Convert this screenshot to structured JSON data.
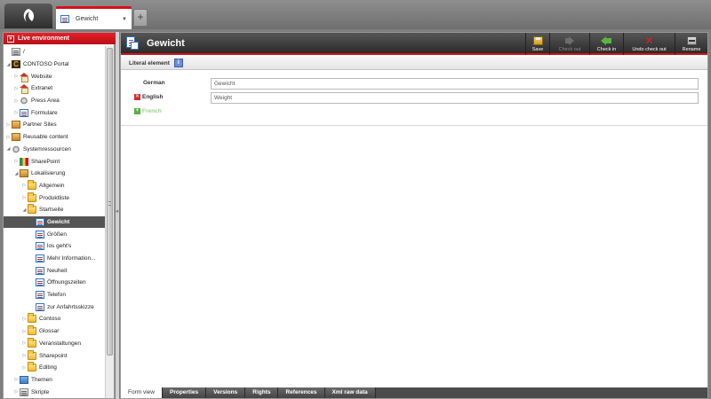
{
  "topbar": {
    "tab_label": "Gewicht",
    "add_tab_glyph": "+"
  },
  "sidebar": {
    "environment_label": "Live environment",
    "tree": [
      {
        "label": "/",
        "depth": 0,
        "toggle": "",
        "icon": "server"
      },
      {
        "label": "CONTOSO Portal",
        "depth": 0,
        "toggle": "◢",
        "icon": "brand"
      },
      {
        "label": "Website",
        "depth": 1,
        "toggle": "▷",
        "icon": "house"
      },
      {
        "label": "Extranet",
        "depth": 1,
        "toggle": "▷",
        "icon": "house"
      },
      {
        "label": "Press Area",
        "depth": 1,
        "toggle": "▷",
        "icon": "gear"
      },
      {
        "label": "Formulare",
        "depth": 1,
        "toggle": "▷",
        "icon": "doc"
      },
      {
        "label": "Partner Sites",
        "depth": 0,
        "toggle": "▷",
        "icon": "box"
      },
      {
        "label": "Reusable content",
        "depth": 0,
        "toggle": "▷",
        "icon": "box"
      },
      {
        "label": "Systemressourcen",
        "depth": 0,
        "toggle": "◢",
        "icon": "gear"
      },
      {
        "label": "SharePoint",
        "depth": 1,
        "toggle": "▷",
        "icon": "sp"
      },
      {
        "label": "Lokalisierung",
        "depth": 1,
        "toggle": "◢",
        "icon": "box"
      },
      {
        "label": "Allgemein",
        "depth": 2,
        "toggle": "▷",
        "icon": "folder"
      },
      {
        "label": "Produktliste",
        "depth": 2,
        "toggle": "▷",
        "icon": "folder"
      },
      {
        "label": "Startseite",
        "depth": 2,
        "toggle": "◢",
        "icon": "folder"
      },
      {
        "label": "Gewicht",
        "depth": 3,
        "toggle": "",
        "icon": "doc",
        "selected": true
      },
      {
        "label": "Größen",
        "depth": 3,
        "toggle": "",
        "icon": "doc"
      },
      {
        "label": "los geht's",
        "depth": 3,
        "toggle": "",
        "icon": "doc"
      },
      {
        "label": "Mehr Information...",
        "depth": 3,
        "toggle": "",
        "icon": "doc"
      },
      {
        "label": "Neuheit",
        "depth": 3,
        "toggle": "",
        "icon": "doc"
      },
      {
        "label": "Öffnungszeiten",
        "depth": 3,
        "toggle": "",
        "icon": "doc"
      },
      {
        "label": "Telefon",
        "depth": 3,
        "toggle": "",
        "icon": "doc"
      },
      {
        "label": "zur Anfahrtsskizze",
        "depth": 3,
        "toggle": "",
        "icon": "doc"
      },
      {
        "label": "Contoso",
        "depth": 2,
        "toggle": "▷",
        "icon": "folder"
      },
      {
        "label": "Glossar",
        "depth": 2,
        "toggle": "▷",
        "icon": "folder"
      },
      {
        "label": "Veranstaltungen",
        "depth": 2,
        "toggle": "▷",
        "icon": "folder"
      },
      {
        "label": "Sharepoint",
        "depth": 2,
        "toggle": "▷",
        "icon": "folder"
      },
      {
        "label": "Editing",
        "depth": 2,
        "toggle": "▷",
        "icon": "folder"
      },
      {
        "label": "Themen",
        "depth": 1,
        "toggle": "▷",
        "icon": "img"
      },
      {
        "label": "Skripte",
        "depth": 1,
        "toggle": "▷",
        "icon": "server"
      }
    ]
  },
  "editor": {
    "title": "Gewicht",
    "toolbar": [
      {
        "label": "Save",
        "icon": "save-icon",
        "enabled": true
      },
      {
        "label": "Check out",
        "icon": "check-out-icon",
        "enabled": false
      },
      {
        "label": "Check in",
        "icon": "check-in-icon",
        "enabled": true
      },
      {
        "label": "Undo check out",
        "icon": "undo-check-out-icon",
        "enabled": true
      },
      {
        "label": "Rename",
        "icon": "rename-icon",
        "enabled": true
      }
    ],
    "subbar_label": "Literal element",
    "info_glyph": "i",
    "fields": [
      {
        "language": "German",
        "value": "Gewicht",
        "status": "none"
      },
      {
        "language": "English",
        "value": "Weight",
        "status": "error"
      },
      {
        "language": "French",
        "value": "",
        "status": "add"
      }
    ],
    "bottom_tabs": [
      "Form view",
      "Properties",
      "Versions",
      "Rights",
      "References",
      "Xml raw data"
    ]
  },
  "colors": {
    "accent": "#d4121b",
    "header_bg": "#2b2b2b",
    "selected_row": "#555555"
  }
}
